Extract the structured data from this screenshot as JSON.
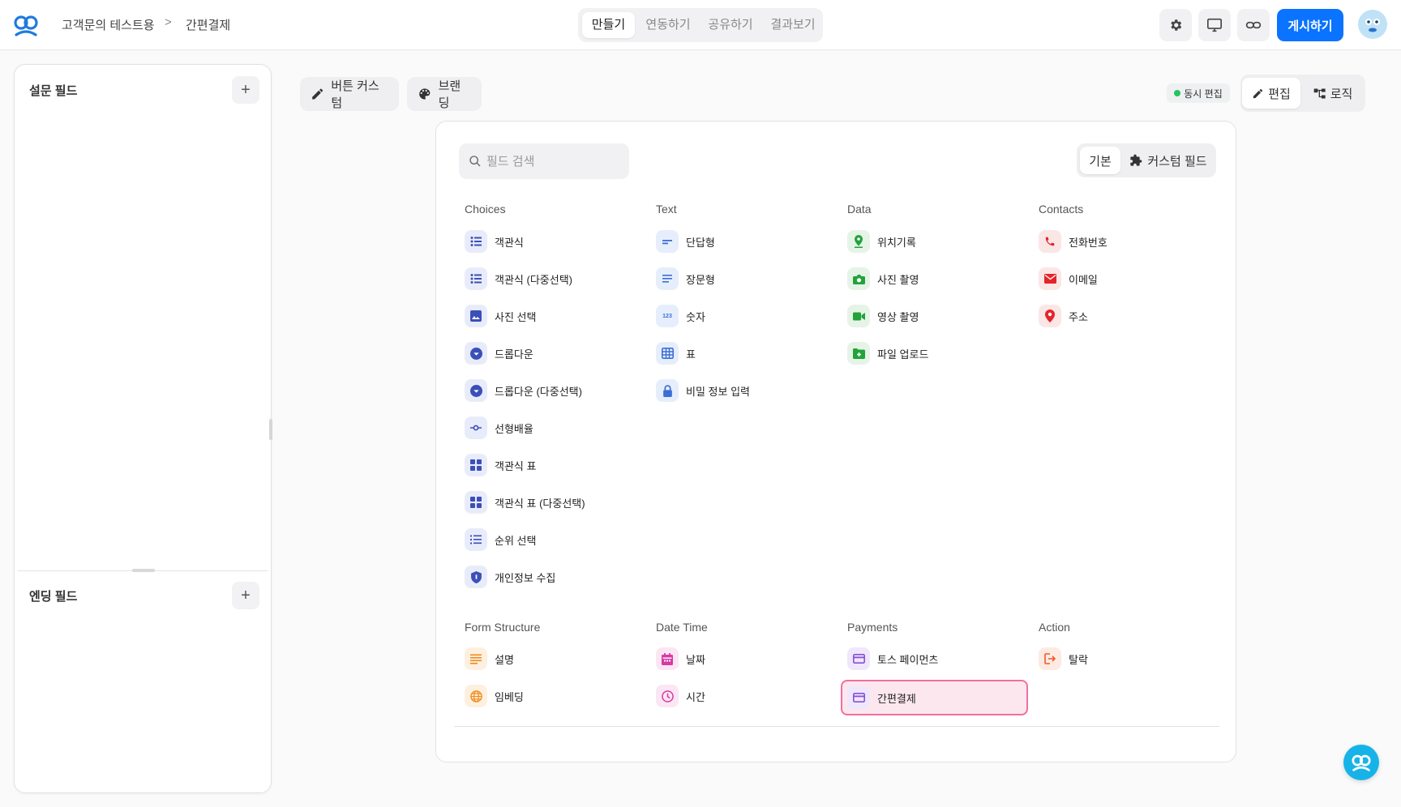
{
  "breadcrumb": {
    "workspace": "고객문의 테스트용",
    "separator": ">",
    "current": "간편결제"
  },
  "main_tabs": [
    "만들기",
    "연동하기",
    "공유하기",
    "결과보기"
  ],
  "header": {
    "publish_label": "게시하기"
  },
  "left_panel": {
    "survey_title": "설문 필드",
    "ending_title": "엔딩 필드",
    "plus": "+"
  },
  "toolbar": {
    "button_custom": "버튼 커스텀",
    "branding": "브랜딩",
    "live_edit": "동시 편집",
    "edit": "편집",
    "logic": "로직"
  },
  "search": {
    "placeholder": "필드 검색"
  },
  "segment": {
    "basic": "기본",
    "custom": "커스텀 필드"
  },
  "categories": {
    "choices": {
      "title": "Choices",
      "items": [
        "객관식",
        "객관식 (다중선택)",
        "사진 선택",
        "드롭다운",
        "드롭다운 (다중선택)",
        "선형배율",
        "객관식 표",
        "객관식 표 (다중선택)",
        "순위 선택",
        "개인정보 수집"
      ]
    },
    "text": {
      "title": "Text",
      "items": [
        "단답형",
        "장문형",
        "숫자",
        "표",
        "비밀 정보 입력"
      ]
    },
    "data": {
      "title": "Data",
      "items": [
        "위치기록",
        "사진 촬영",
        "영상 촬영",
        "파일 업로드"
      ]
    },
    "contacts": {
      "title": "Contacts",
      "items": [
        "전화번호",
        "이메일",
        "주소"
      ]
    },
    "form_structure": {
      "title": "Form Structure",
      "items": [
        "설명",
        "임베딩"
      ]
    },
    "date_time": {
      "title": "Date Time",
      "items": [
        "날짜",
        "시간"
      ]
    },
    "payments": {
      "title": "Payments",
      "items": [
        "토스 페이먼츠",
        "간편결제"
      ]
    },
    "action": {
      "title": "Action",
      "items": [
        "탈락"
      ]
    }
  },
  "colors": {
    "primary": "#0a73ff",
    "choices": "#3b4fb8",
    "text": "#3b6fd6",
    "data": "#22a33a",
    "contacts": "#e5242a",
    "structure": "#f08c1a",
    "datetime": "#d63aa6",
    "payments": "#8a4fd8",
    "action": "#ef5a2a",
    "selected_border": "#ef6fa0"
  }
}
